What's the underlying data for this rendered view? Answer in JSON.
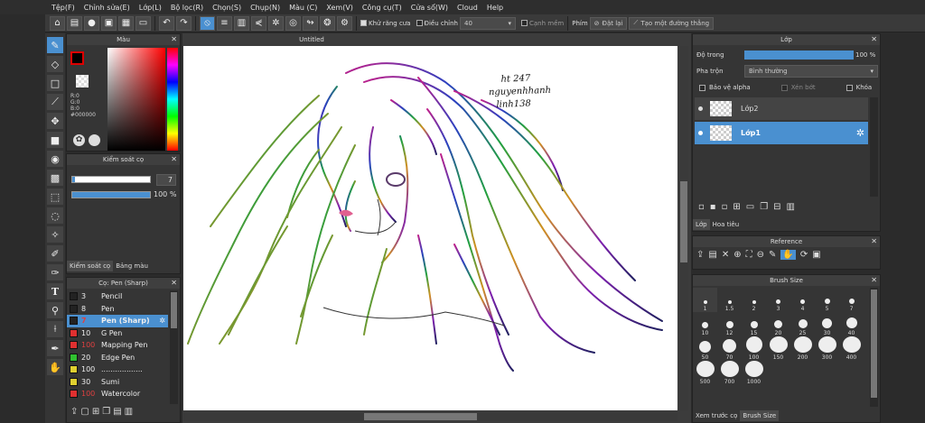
{
  "menu": [
    "Tệp(F)",
    "Chỉnh sửa(E)",
    "Lớp(L)",
    "Bộ lọc(R)",
    "Chọn(S)",
    "Chụp(N)",
    "Màu (C)",
    "Xem(V)",
    "Công cụ(T)",
    "Cửa sổ(W)",
    "Cloud",
    "Help"
  ],
  "toolbar": {
    "antialias_label": "Khử răng cưa",
    "adjust_label": "Điều chỉnh",
    "adjust_value": "40",
    "soft_label": "Cạnh mềm",
    "key_label": "Phím",
    "reset_label": "Đặt lại",
    "straight_label": "Tạo một đường thẳng"
  },
  "color_panel": {
    "title": "Màu",
    "r": "R:0",
    "g": "G:0",
    "b": "B:0",
    "hex": "#000000"
  },
  "brush_control": {
    "title": "Kiểm soát cọ",
    "size": "7",
    "opacity": "100 %",
    "tab1": "Kiểm soát cọ",
    "tab2": "Bảng màu"
  },
  "brush_panel": {
    "title": "Cọ: Pen (Sharp)",
    "items": [
      {
        "size": "3",
        "name": "Pencil",
        "color": "#222222",
        "numcolor": "#eeeeee"
      },
      {
        "size": "8",
        "name": "Pen",
        "color": "#222222",
        "numcolor": "#eeeeee"
      },
      {
        "size": "7",
        "name": "Pen (Sharp)",
        "color": "#222222",
        "numcolor": "#e04040"
      },
      {
        "size": "10",
        "name": "G Pen",
        "color": "#e03030",
        "numcolor": "#eeeeee"
      },
      {
        "size": "100",
        "name": "Mapping Pen",
        "color": "#e03030",
        "numcolor": "#e04040"
      },
      {
        "size": "20",
        "name": "Edge Pen",
        "color": "#30c030",
        "numcolor": "#eeeeee"
      },
      {
        "size": "100",
        "name": "..................",
        "color": "#e0d030",
        "numcolor": "#eeeeee"
      },
      {
        "size": "30",
        "name": "Sumi",
        "color": "#e0d030",
        "numcolor": "#eeeeee"
      },
      {
        "size": "100",
        "name": "Watercolor",
        "color": "#e03030",
        "numcolor": "#e04040"
      }
    ]
  },
  "canvas": {
    "tab": "Untitled",
    "handwriting": [
      "ht 247",
      "nguyenhhanh",
      "linh138"
    ]
  },
  "layer_panel": {
    "title": "Lớp",
    "opacity_label": "Độ trong",
    "opacity_value": "100 %",
    "blend_label": "Pha trộn",
    "blend_value": "Bình thường",
    "protect_alpha": "Bảo vệ alpha",
    "clipping": "Xén bớt",
    "lock": "Khóa",
    "layers": [
      "Lớp2",
      "Lớp1"
    ],
    "tab1": "Lớp",
    "tab2": "Hoa tiêu"
  },
  "reference": {
    "title": "Reference"
  },
  "brush_size": {
    "title": "Brush Size",
    "sizes": [
      "1",
      "1.5",
      "2",
      "3",
      "4",
      "5",
      "7",
      "10",
      "12",
      "15",
      "20",
      "25",
      "30",
      "40",
      "50",
      "70",
      "100",
      "150",
      "200",
      "300",
      "400",
      "500",
      "700",
      "1000"
    ],
    "tab1": "Xem trước cọ",
    "tab2": "Brush Size"
  },
  "colors": {
    "accent": "#4a90d0",
    "bg": "#2b2b2b"
  }
}
